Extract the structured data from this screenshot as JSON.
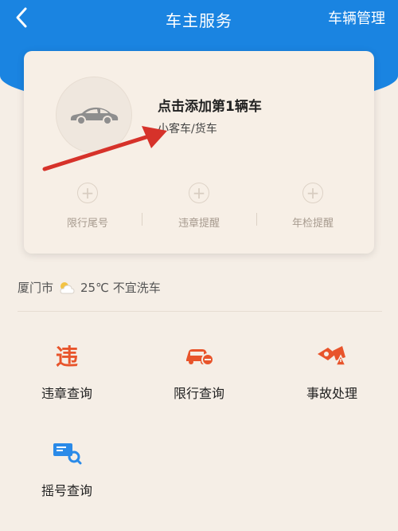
{
  "navbar": {
    "title": "车主服务",
    "right_label": "车辆管理"
  },
  "add_car_card": {
    "title": "点击添加第1辆车",
    "subtitle": "小客车/货车",
    "features": [
      {
        "label": "限行尾号",
        "icon": "plus-icon"
      },
      {
        "label": "违章提醒",
        "icon": "plus-icon"
      },
      {
        "label": "年检提醒",
        "icon": "plus-icon"
      }
    ],
    "plus_glyph": "+"
  },
  "weather": {
    "city": "厦门市",
    "icon": "partly-cloudy-icon",
    "text": "25℃ 不宜洗车"
  },
  "services": [
    {
      "label": "违章查询",
      "icon": "violation-icon"
    },
    {
      "label": "限行查询",
      "icon": "restriction-car-icon"
    },
    {
      "label": "事故处理",
      "icon": "accident-icon"
    },
    {
      "label": "摇号查询",
      "icon": "lottery-search-icon"
    }
  ],
  "services_icon_text": {
    "violation": "违"
  },
  "colors": {
    "header_blue": "#1a84e1",
    "accent_orange": "#e8542b",
    "arrow_red": "#d6322a",
    "lottery_blue": "#2a8ae8"
  }
}
